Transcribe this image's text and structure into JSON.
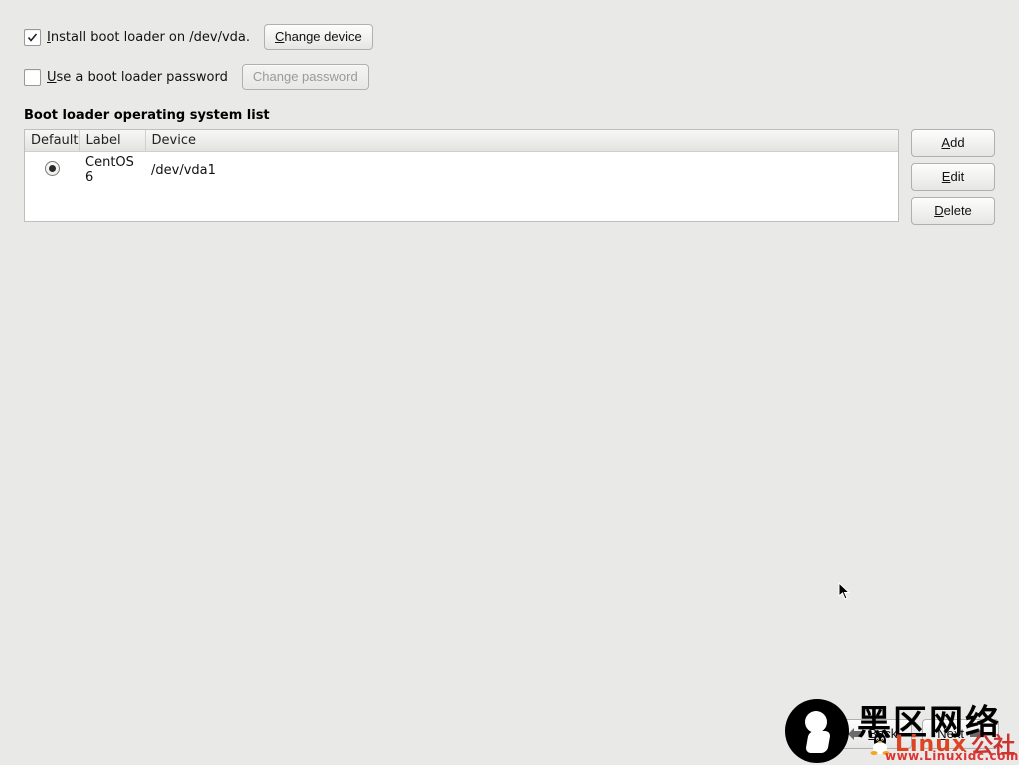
{
  "options": {
    "install_checked": true,
    "install_label_pre": "I",
    "install_label_rest": "nstall boot loader on /dev/vda.",
    "change_device_pre": "C",
    "change_device_rest": "hange device",
    "password_checked": false,
    "password_label_pre": "U",
    "password_label_rest": "se a boot loader password",
    "change_password": "Change password"
  },
  "list": {
    "title": "Boot loader operating system list",
    "headers": {
      "default": "Default",
      "label": "Label",
      "device": "Device"
    },
    "rows": [
      {
        "default": true,
        "label": "CentOS 6",
        "device": "/dev/vda1"
      }
    ],
    "buttons": {
      "add_pre": "A",
      "add_rest": "dd",
      "edit_pre": "E",
      "edit_rest": "dit",
      "delete_pre": "D",
      "delete_rest": "elete"
    }
  },
  "nav": {
    "back_pre": "B",
    "back_rest": "ack",
    "next_pre": "N",
    "next_rest": "ext"
  },
  "watermark": {
    "cn": "黑区网络",
    "brand": "Linux",
    "she": "公社",
    "url": "www.Linuxidc.com"
  }
}
